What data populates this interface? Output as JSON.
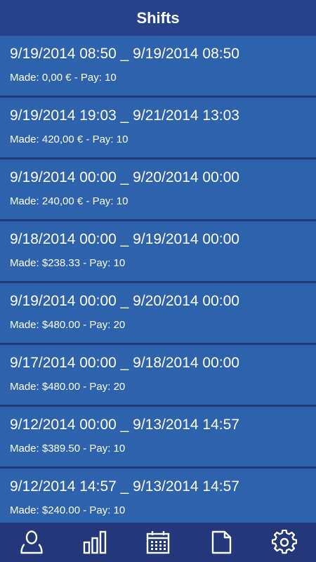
{
  "header": {
    "title": "Shifts"
  },
  "shifts": [
    {
      "range": "9/19/2014 08:50 _ 9/19/2014 08:50",
      "made": "Made: 0,00 € - Pay: 10"
    },
    {
      "range": "9/19/2014 19:03 _ 9/21/2014 13:03",
      "made": "Made: 420,00 € - Pay: 10"
    },
    {
      "range": "9/19/2014 00:00 _ 9/20/2014 00:00",
      "made": "Made: 240,00 € - Pay: 10"
    },
    {
      "range": "9/18/2014 00:00 _ 9/19/2014 00:00",
      "made": "Made: $238.33 - Pay: 10"
    },
    {
      "range": "9/19/2014 00:00 _ 9/20/2014 00:00",
      "made": "Made: $480.00 - Pay: 20"
    },
    {
      "range": "9/17/2014 00:00 _ 9/18/2014 00:00",
      "made": "Made: $480.00 - Pay: 20"
    },
    {
      "range": "9/12/2014 00:00 _ 9/13/2014 14:57",
      "made": "Made: $389.50 - Pay: 10"
    },
    {
      "range": "9/12/2014 14:57 _ 9/13/2014 14:57",
      "made": "Made: $240.00 - Pay: 10"
    }
  ],
  "nav": {
    "items": [
      {
        "icon": "person-icon"
      },
      {
        "icon": "bar-chart-icon"
      },
      {
        "icon": "calendar-icon"
      },
      {
        "icon": "document-icon"
      },
      {
        "icon": "gear-icon"
      }
    ]
  },
  "colors": {
    "header": "#27418a",
    "item": "#2f62ad",
    "background": "#1f3a78",
    "nav": "#23377a",
    "text": "#ffffff"
  }
}
